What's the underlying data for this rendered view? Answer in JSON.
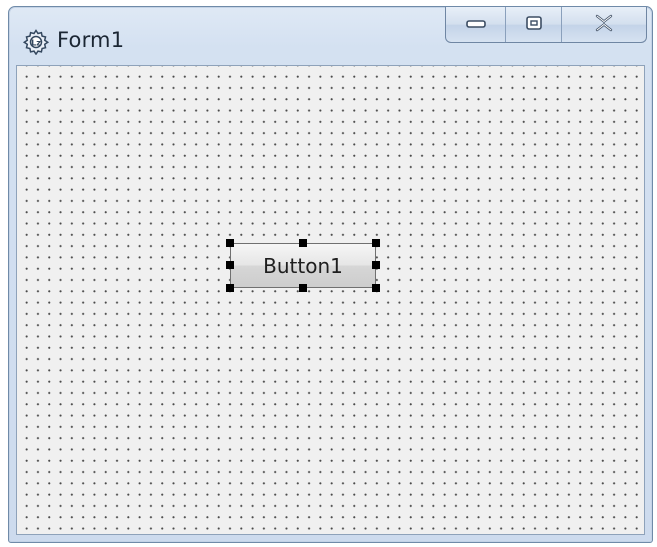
{
  "window": {
    "title": "Form1",
    "icon": "gear-icon"
  },
  "caption_buttons": {
    "minimize_icon": "minimize-icon",
    "maximize_icon": "maximize-icon",
    "close_icon": "close-icon"
  },
  "form": {
    "button": {
      "label": "Button1",
      "selected": true
    }
  },
  "colors": {
    "titlebar": "#d4e1f1",
    "client": "#f0f0f0",
    "grid_dot": "#4a4a4a",
    "selection_handle": "#000000"
  }
}
